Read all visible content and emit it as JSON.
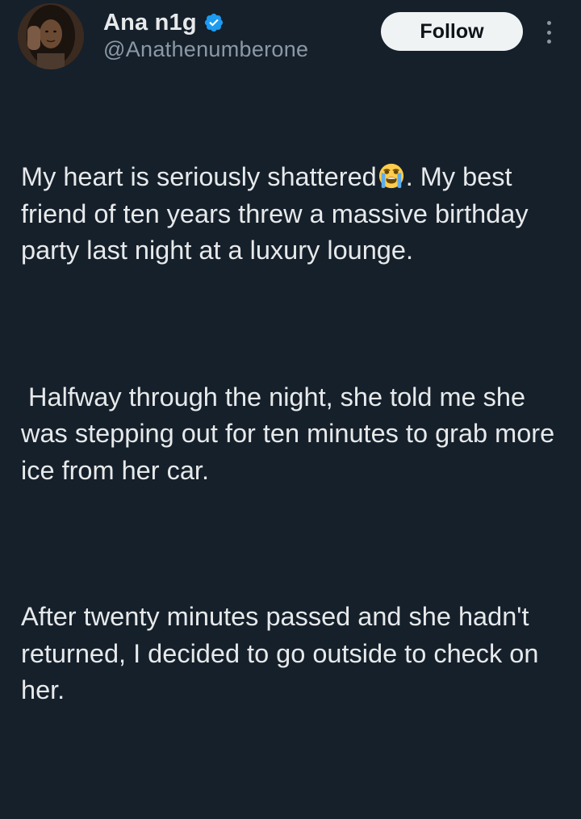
{
  "author": {
    "display_name": "Ana n1g",
    "handle": "@Anathenumberone",
    "avatar_icon": "profile-photo",
    "verified_icon": "verified-badge-icon",
    "verified_color": "#1d9bf0"
  },
  "actions": {
    "follow_label": "Follow",
    "more_icon": "more-vertical-icon"
  },
  "tweet": {
    "p1_before_emoji": "My heart is seriously shattered",
    "p1_emoji": "loudly-crying-face",
    "p1_after_emoji": ". My best friend of ten years threw a massive birthday party last night at a luxury lounge.",
    "p2": " Halfway through the night, she told me she was stepping out for ten minutes to grab more ice from her car.",
    "p3": "After twenty minutes passed and she hadn't returned, I decided to go outside to check on her."
  },
  "theme": {
    "background": "#15202b",
    "text": "#e7e9ea",
    "secondary_text": "#8b98a5",
    "button_bg": "#eff3f4"
  }
}
